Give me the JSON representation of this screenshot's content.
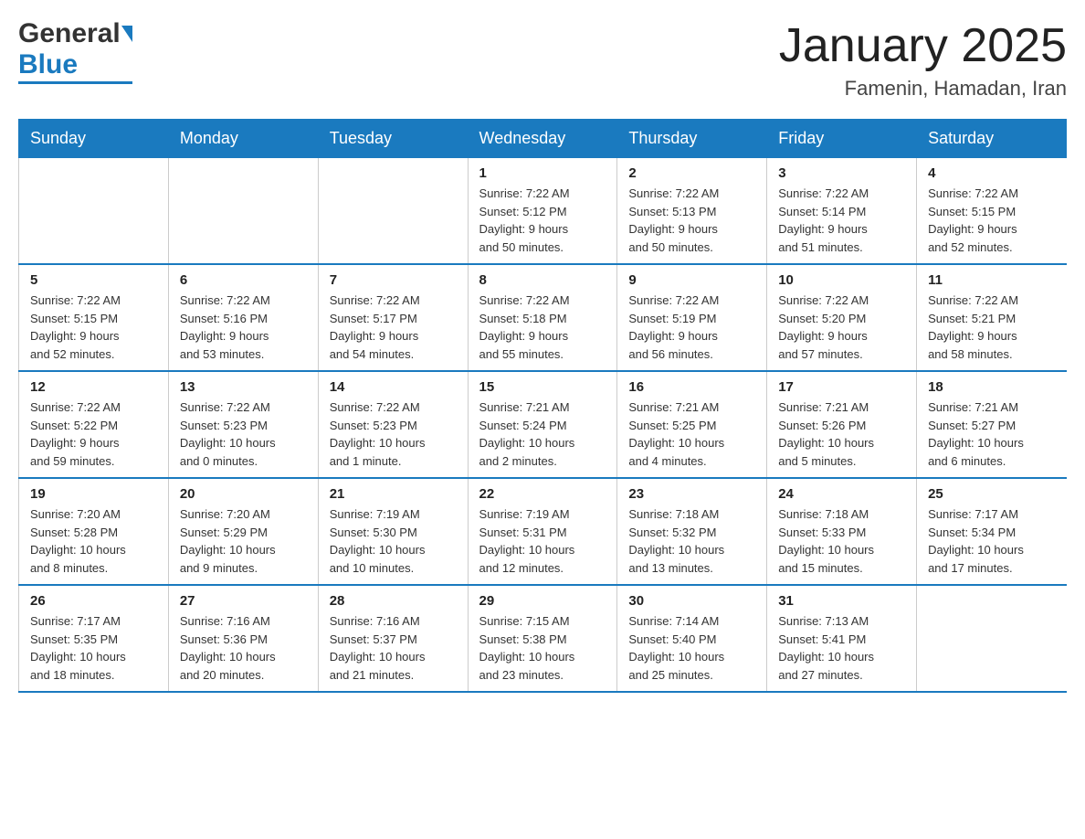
{
  "header": {
    "logo_general": "General",
    "logo_blue": "Blue",
    "title": "January 2025",
    "subtitle": "Famenin, Hamadan, Iran"
  },
  "days_of_week": [
    "Sunday",
    "Monday",
    "Tuesday",
    "Wednesday",
    "Thursday",
    "Friday",
    "Saturday"
  ],
  "weeks": [
    [
      {
        "num": "",
        "info": ""
      },
      {
        "num": "",
        "info": ""
      },
      {
        "num": "",
        "info": ""
      },
      {
        "num": "1",
        "info": "Sunrise: 7:22 AM\nSunset: 5:12 PM\nDaylight: 9 hours\nand 50 minutes."
      },
      {
        "num": "2",
        "info": "Sunrise: 7:22 AM\nSunset: 5:13 PM\nDaylight: 9 hours\nand 50 minutes."
      },
      {
        "num": "3",
        "info": "Sunrise: 7:22 AM\nSunset: 5:14 PM\nDaylight: 9 hours\nand 51 minutes."
      },
      {
        "num": "4",
        "info": "Sunrise: 7:22 AM\nSunset: 5:15 PM\nDaylight: 9 hours\nand 52 minutes."
      }
    ],
    [
      {
        "num": "5",
        "info": "Sunrise: 7:22 AM\nSunset: 5:15 PM\nDaylight: 9 hours\nand 52 minutes."
      },
      {
        "num": "6",
        "info": "Sunrise: 7:22 AM\nSunset: 5:16 PM\nDaylight: 9 hours\nand 53 minutes."
      },
      {
        "num": "7",
        "info": "Sunrise: 7:22 AM\nSunset: 5:17 PM\nDaylight: 9 hours\nand 54 minutes."
      },
      {
        "num": "8",
        "info": "Sunrise: 7:22 AM\nSunset: 5:18 PM\nDaylight: 9 hours\nand 55 minutes."
      },
      {
        "num": "9",
        "info": "Sunrise: 7:22 AM\nSunset: 5:19 PM\nDaylight: 9 hours\nand 56 minutes."
      },
      {
        "num": "10",
        "info": "Sunrise: 7:22 AM\nSunset: 5:20 PM\nDaylight: 9 hours\nand 57 minutes."
      },
      {
        "num": "11",
        "info": "Sunrise: 7:22 AM\nSunset: 5:21 PM\nDaylight: 9 hours\nand 58 minutes."
      }
    ],
    [
      {
        "num": "12",
        "info": "Sunrise: 7:22 AM\nSunset: 5:22 PM\nDaylight: 9 hours\nand 59 minutes."
      },
      {
        "num": "13",
        "info": "Sunrise: 7:22 AM\nSunset: 5:23 PM\nDaylight: 10 hours\nand 0 minutes."
      },
      {
        "num": "14",
        "info": "Sunrise: 7:22 AM\nSunset: 5:23 PM\nDaylight: 10 hours\nand 1 minute."
      },
      {
        "num": "15",
        "info": "Sunrise: 7:21 AM\nSunset: 5:24 PM\nDaylight: 10 hours\nand 2 minutes."
      },
      {
        "num": "16",
        "info": "Sunrise: 7:21 AM\nSunset: 5:25 PM\nDaylight: 10 hours\nand 4 minutes."
      },
      {
        "num": "17",
        "info": "Sunrise: 7:21 AM\nSunset: 5:26 PM\nDaylight: 10 hours\nand 5 minutes."
      },
      {
        "num": "18",
        "info": "Sunrise: 7:21 AM\nSunset: 5:27 PM\nDaylight: 10 hours\nand 6 minutes."
      }
    ],
    [
      {
        "num": "19",
        "info": "Sunrise: 7:20 AM\nSunset: 5:28 PM\nDaylight: 10 hours\nand 8 minutes."
      },
      {
        "num": "20",
        "info": "Sunrise: 7:20 AM\nSunset: 5:29 PM\nDaylight: 10 hours\nand 9 minutes."
      },
      {
        "num": "21",
        "info": "Sunrise: 7:19 AM\nSunset: 5:30 PM\nDaylight: 10 hours\nand 10 minutes."
      },
      {
        "num": "22",
        "info": "Sunrise: 7:19 AM\nSunset: 5:31 PM\nDaylight: 10 hours\nand 12 minutes."
      },
      {
        "num": "23",
        "info": "Sunrise: 7:18 AM\nSunset: 5:32 PM\nDaylight: 10 hours\nand 13 minutes."
      },
      {
        "num": "24",
        "info": "Sunrise: 7:18 AM\nSunset: 5:33 PM\nDaylight: 10 hours\nand 15 minutes."
      },
      {
        "num": "25",
        "info": "Sunrise: 7:17 AM\nSunset: 5:34 PM\nDaylight: 10 hours\nand 17 minutes."
      }
    ],
    [
      {
        "num": "26",
        "info": "Sunrise: 7:17 AM\nSunset: 5:35 PM\nDaylight: 10 hours\nand 18 minutes."
      },
      {
        "num": "27",
        "info": "Sunrise: 7:16 AM\nSunset: 5:36 PM\nDaylight: 10 hours\nand 20 minutes."
      },
      {
        "num": "28",
        "info": "Sunrise: 7:16 AM\nSunset: 5:37 PM\nDaylight: 10 hours\nand 21 minutes."
      },
      {
        "num": "29",
        "info": "Sunrise: 7:15 AM\nSunset: 5:38 PM\nDaylight: 10 hours\nand 23 minutes."
      },
      {
        "num": "30",
        "info": "Sunrise: 7:14 AM\nSunset: 5:40 PM\nDaylight: 10 hours\nand 25 minutes."
      },
      {
        "num": "31",
        "info": "Sunrise: 7:13 AM\nSunset: 5:41 PM\nDaylight: 10 hours\nand 27 minutes."
      },
      {
        "num": "",
        "info": ""
      }
    ]
  ]
}
